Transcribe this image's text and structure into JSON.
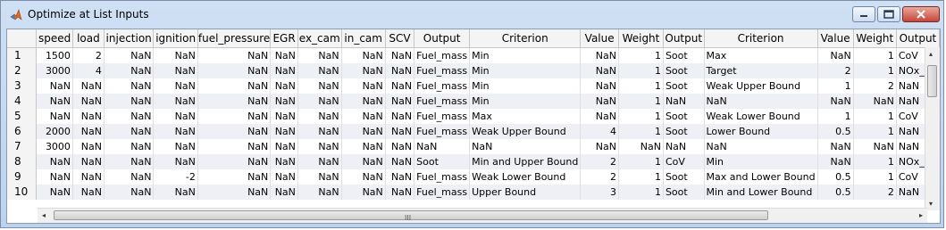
{
  "window": {
    "title": "Optimize at List Inputs"
  },
  "table": {
    "columns": [
      "speed",
      "load",
      "injection",
      "ignition",
      "fuel_pressure",
      "EGR",
      "ex_cam",
      "in_cam",
      "SCV",
      "Output",
      "Criterion",
      "Value",
      "Weight",
      "Output",
      "Criterion",
      "Value",
      "Weight",
      "Output"
    ],
    "rows": [
      [
        "1",
        "1500",
        "2",
        "NaN",
        "NaN",
        "NaN",
        "NaN",
        "NaN",
        "NaN",
        "NaN",
        "Fuel_mass",
        "Min",
        "NaN",
        "1",
        "Soot",
        "Max",
        "NaN",
        "1",
        "CoV"
      ],
      [
        "2",
        "3000",
        "4",
        "NaN",
        "NaN",
        "NaN",
        "NaN",
        "NaN",
        "NaN",
        "NaN",
        "Fuel_mass",
        "Min",
        "NaN",
        "1",
        "Soot",
        "Target",
        "2",
        "1",
        "NOx_rel"
      ],
      [
        "3",
        "NaN",
        "NaN",
        "NaN",
        "NaN",
        "NaN",
        "NaN",
        "NaN",
        "NaN",
        "NaN",
        "Fuel_mass",
        "Min",
        "NaN",
        "1",
        "Soot",
        "Weak Upper Bound",
        "1",
        "2",
        "NaN"
      ],
      [
        "4",
        "NaN",
        "NaN",
        "NaN",
        "NaN",
        "NaN",
        "NaN",
        "NaN",
        "NaN",
        "NaN",
        "Fuel_mass",
        "Min",
        "NaN",
        "1",
        "NaN",
        "NaN",
        "NaN",
        "NaN",
        "NaN"
      ],
      [
        "5",
        "NaN",
        "NaN",
        "NaN",
        "NaN",
        "NaN",
        "NaN",
        "NaN",
        "NaN",
        "NaN",
        "Fuel_mass",
        "Max",
        "NaN",
        "1",
        "Soot",
        "Weak Lower Bound",
        "1",
        "1",
        "CoV"
      ],
      [
        "6",
        "2000",
        "NaN",
        "NaN",
        "NaN",
        "NaN",
        "NaN",
        "NaN",
        "NaN",
        "NaN",
        "Fuel_mass",
        "Weak Upper Bound",
        "4",
        "1",
        "Soot",
        "Lower Bound",
        "0.5",
        "1",
        "NaN"
      ],
      [
        "7",
        "3000",
        "NaN",
        "NaN",
        "NaN",
        "NaN",
        "NaN",
        "NaN",
        "NaN",
        "NaN",
        "NaN",
        "NaN",
        "NaN",
        "NaN",
        "NaN",
        "NaN",
        "NaN",
        "NaN",
        "NaN"
      ],
      [
        "8",
        "NaN",
        "NaN",
        "NaN",
        "NaN",
        "NaN",
        "NaN",
        "NaN",
        "NaN",
        "NaN",
        "Soot",
        "Min and Upper Bound",
        "2",
        "1",
        "CoV",
        "Min",
        "NaN",
        "1",
        "NOx_rel"
      ],
      [
        "9",
        "NaN",
        "NaN",
        "NaN",
        "-2",
        "NaN",
        "NaN",
        "NaN",
        "NaN",
        "NaN",
        "Fuel_mass",
        "Weak Lower Bound",
        "2",
        "1",
        "Soot",
        "Max and Lower Bound",
        "0.5",
        "1",
        "CoV"
      ],
      [
        "10",
        "NaN",
        "NaN",
        "NaN",
        "NaN",
        "NaN",
        "NaN",
        "NaN",
        "NaN",
        "NaN",
        "Fuel_mass",
        "Upper Bound",
        "3",
        "1",
        "Soot",
        "Min and Lower Bound",
        "0.5",
        "2",
        "NaN"
      ]
    ]
  },
  "scroll": {
    "grip": "III",
    "left": "◂",
    "right": "▸"
  },
  "icons": {
    "app": "matlab-logo-icon",
    "minimize": "minimize-icon",
    "maximize": "maximize-icon",
    "close": "close-icon"
  }
}
